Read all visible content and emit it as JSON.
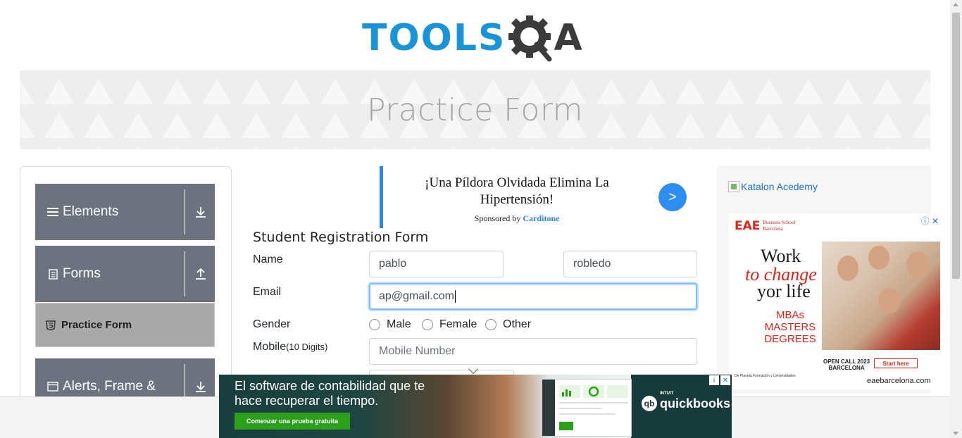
{
  "logo": {
    "text_left": "TOOLS",
    "text_right": "A",
    "alt": "TOOLSQA"
  },
  "banner": {
    "title": "Practice Form"
  },
  "sidebar": {
    "groups": [
      {
        "label": "Elements",
        "icon": "list-icon",
        "arrow": "download-arrow-icon"
      },
      {
        "label": "Forms",
        "icon": "document-icon",
        "arrow": "upload-arrow-icon"
      },
      {
        "label": "Alerts, Frame &",
        "icon": "window-icon",
        "arrow": "download-arrow-icon"
      }
    ],
    "active_item": {
      "label": "Practice Form",
      "icon": "html5-icon"
    }
  },
  "top_ad": {
    "headline": "¡Una Píldora Olvidada Elimina La Hipertensión!",
    "sponsored_prefix": "Sponsored by",
    "sponsor": "Carditone",
    "go_label": ">"
  },
  "form": {
    "title": "Student Registration Form",
    "name_label": "Name",
    "first_name_value": "pablo",
    "last_name_value": "robledo",
    "email_label": "Email",
    "email_value": "ap@gmail.com",
    "gender_label": "Gender",
    "gender_options": [
      "Male",
      "Female",
      "Other"
    ],
    "mobile_label": "Mobile",
    "mobile_hint": "(10 Digits)",
    "mobile_placeholder": "Mobile Number"
  },
  "right_ad": {
    "katalon_text": "Katalon Acedemy",
    "eae": {
      "brand": "EAE",
      "brand_sub_1": "Business School",
      "brand_sub_2": "Barcelona",
      "adchoice": "i",
      "line1": "Work",
      "line2": "to change",
      "line3": "yor life",
      "degrees": "MBAs MASTERS DEGREES",
      "call_1": "OPEN CALL 2023",
      "call_2": "BARCELONA",
      "start": "Start here",
      "footer": "De Planeta Formación y Universidades",
      "url": "eaebarcelona.com"
    }
  },
  "bottom_ad": {
    "headline_1": "El software de contabilidad que te",
    "headline_2": "hace recuperar el tiempo.",
    "cta": "Comenzar una prueba gratuita",
    "brand_small": "INTUIT",
    "brand": "quickbooks",
    "adchoice": "i"
  },
  "colors": {
    "brand_blue": "#1a94d7",
    "sidebar_group": "#6c737e",
    "active_item": "#a9a9a9",
    "focus_border": "#80bdff",
    "ad_accent": "#2d85e6",
    "quickbooks_green": "#2ca01c"
  }
}
